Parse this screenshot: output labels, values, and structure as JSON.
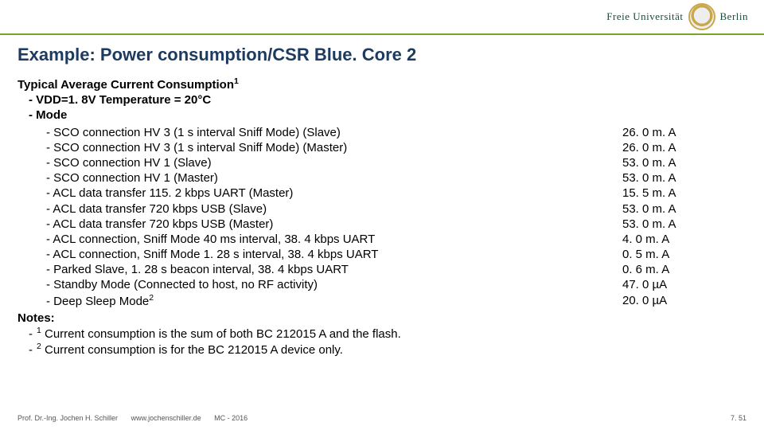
{
  "header": {
    "uni_left": "Freie Universität",
    "uni_right": "Berlin"
  },
  "title": "Example: Power consumption/CSR Blue. Core 2",
  "section": {
    "heading_pre": "Typical Average Current Consumption",
    "heading_sup": "1",
    "cond_dash": "- ",
    "cond": "VDD=1. 8V   Temperature = 20°C",
    "mode_dash": "- ",
    "mode": "Mode"
  },
  "rows": [
    {
      "label": "SCO connection HV 3 (1 s interval Sniff Mode) (Slave)",
      "value": "26. 0 m. A"
    },
    {
      "label": "SCO connection HV 3 (1 s interval Sniff Mode) (Master)",
      "value": "26. 0 m. A"
    },
    {
      "label": "SCO connection HV 1 (Slave)",
      "value": "53. 0 m. A"
    },
    {
      "label": "SCO connection HV 1 (Master)",
      "value": "53. 0 m. A"
    },
    {
      "label": "ACL data transfer 115. 2 kbps UART (Master)",
      "value": "15. 5 m. A"
    },
    {
      "label": "ACL data transfer 720 kbps USB (Slave)",
      "value": "53. 0 m. A"
    },
    {
      "label": "ACL data transfer 720 kbps USB (Master)",
      "value": "53. 0 m. A"
    },
    {
      "label": "ACL connection, Sniff Mode 40 ms interval, 38. 4 kbps UART",
      "value": "4. 0 m. A"
    },
    {
      "label": "ACL connection, Sniff Mode 1. 28 s interval, 38. 4 kbps UART",
      "value": "0. 5 m. A"
    },
    {
      "label": "Parked Slave, 1. 28 s beacon interval, 38. 4 kbps UART",
      "value": "0. 6 m. A"
    },
    {
      "label": "Standby Mode (Connected to host, no RF activity)",
      "value": "47. 0 µA"
    },
    {
      "label_pre": "Deep Sleep Mode",
      "label_sup": "2",
      "value": "20. 0 µA"
    }
  ],
  "notes": {
    "heading": "Notes:",
    "n1_sup": "1",
    "n1_text": " Current consumption is the sum of both BC 212015 A and the flash.",
    "n2_sup": "2",
    "n2_text": " Current consumption is for the BC 212015 A device only."
  },
  "footer": {
    "author": "Prof. Dr.-Ing. Jochen H. Schiller",
    "url": "www.jochenschiller.de",
    "course": "MC - 2016",
    "page": "7. 51"
  }
}
